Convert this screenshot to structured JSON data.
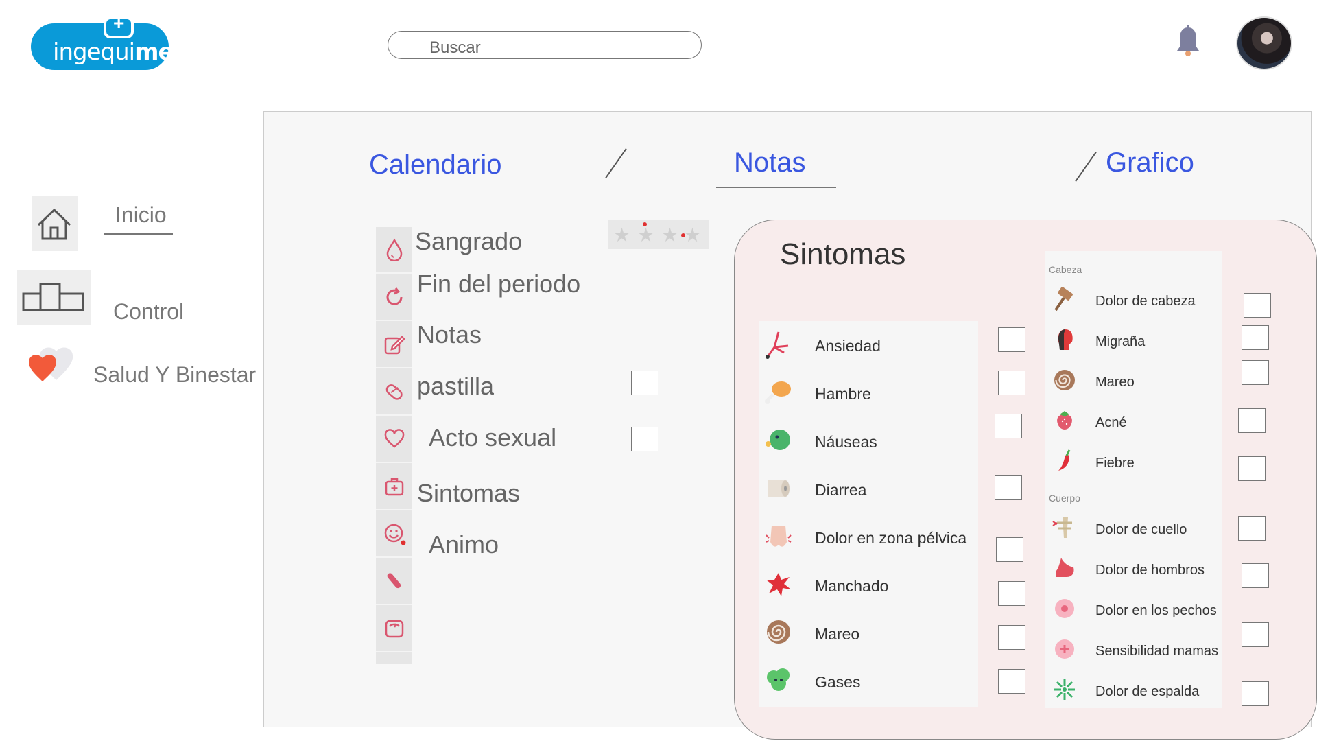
{
  "header": {
    "logo_text_light": "ingequi",
    "logo_text_bold": "med",
    "logo_plus": "+",
    "search_placeholder": "Buscar"
  },
  "sidebar": {
    "items": [
      {
        "label": "Inicio",
        "icon": "home-icon"
      },
      {
        "label": "Control",
        "icon": "podium-icon"
      },
      {
        "label": "Salud Y Binestar",
        "icon": "heart-icon"
      }
    ]
  },
  "tabs": {
    "calendario": "Calendario",
    "notas": "Notas",
    "grafico": "Grafico",
    "active": "Notas"
  },
  "tracking": {
    "sangrado": "Sangrado",
    "fin_periodo": "Fin del periodo",
    "notas": "Notas",
    "pastilla": "pastilla",
    "acto_sexual": "Acto sexual",
    "sintomas": "Sintomas",
    "animo": "Animo"
  },
  "symptoms": {
    "title": "Sintomas",
    "general": [
      {
        "label": "Ansiedad",
        "icon": "lightning-icon"
      },
      {
        "label": "Hambre",
        "icon": "drumstick-icon"
      },
      {
        "label": "Náuseas",
        "icon": "nausea-face-icon"
      },
      {
        "label": "Diarrea",
        "icon": "toilet-paper-icon"
      },
      {
        "label": "Dolor en zona pélvica",
        "icon": "pelvis-icon"
      },
      {
        "label": "Manchado",
        "icon": "splatter-icon"
      },
      {
        "label": "Mareo",
        "icon": "spiral-icon"
      },
      {
        "label": "Gases",
        "icon": "gas-cloud-icon"
      }
    ],
    "cabeza_header": "Cabeza",
    "cabeza": [
      {
        "label": "Dolor de cabeza",
        "icon": "hammer-icon"
      },
      {
        "label": "Migraña",
        "icon": "head-pain-icon"
      },
      {
        "label": "Mareo",
        "icon": "spiral-icon"
      },
      {
        "label": "Acné",
        "icon": "strawberry-icon"
      },
      {
        "label": "Fiebre",
        "icon": "chili-icon"
      }
    ],
    "cuerpo_header": "Cuerpo",
    "cuerpo": [
      {
        "label": "Dolor de cuello",
        "icon": "neck-icon"
      },
      {
        "label": "Dolor de hombros",
        "icon": "shoulder-icon"
      },
      {
        "label": "Dolor en los pechos",
        "icon": "breast-icon"
      },
      {
        "label": "Sensibilidad mamas",
        "icon": "breast-plus-icon"
      },
      {
        "label": "Dolor de espalda",
        "icon": "back-icon"
      }
    ]
  },
  "colors": {
    "accent_blue": "#3a57e0",
    "logo_blue": "#0a9ad8",
    "icon_pink": "#d9566f",
    "panel_pink": "#f8ecec"
  }
}
